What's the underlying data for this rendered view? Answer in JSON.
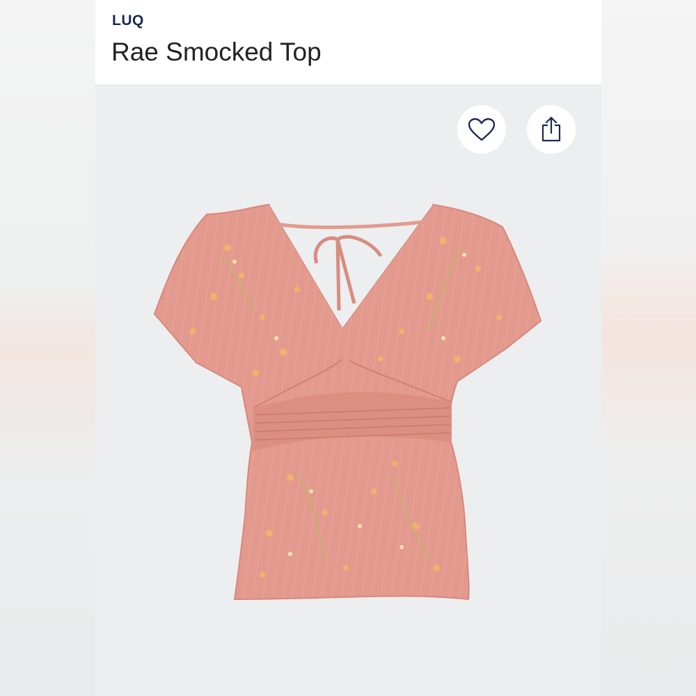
{
  "product": {
    "brand": "LUQ",
    "name": "Rae Smocked Top"
  },
  "actions": {
    "favorite_icon": "heart-icon",
    "share_icon": "share-icon"
  },
  "colors": {
    "brand_text": "#1b2a52",
    "fabric": "#e39a8e",
    "flowers": "#f3b26a"
  }
}
